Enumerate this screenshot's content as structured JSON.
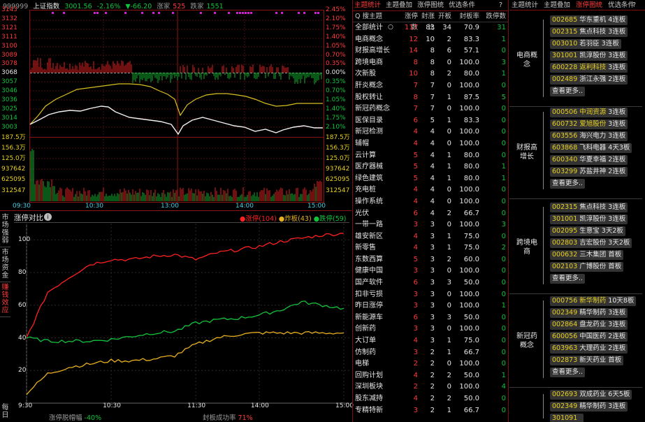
{
  "index": {
    "code": "999999",
    "name": "上证指数",
    "price": "3001.56",
    "pct": "-2.16%",
    "change": "▼-66.20",
    "up_label": "涨家",
    "up_count": "525",
    "down_label": "跌家",
    "down_count": "1551",
    "y_left": [
      "3143",
      "3132",
      "3121",
      "3111",
      "3100",
      "3089",
      "3078",
      "3068",
      "3057",
      "3046",
      "3036",
      "3025",
      "3014",
      "3003"
    ],
    "y_right": [
      "2.45%",
      "2.10%",
      "1.75%",
      "1.40%",
      "1.05%",
      "0.70%",
      "0.35%",
      "0.00%",
      "0.35%",
      "0.70%",
      "1.05%",
      "1.40%",
      "1.75%",
      "2.10%"
    ],
    "vol_left": [
      "187.5万",
      "156.3万",
      "125.0万",
      "937642",
      "625095",
      "312547"
    ],
    "vol_right": [
      "187.5万",
      "156.3万",
      "125.0万",
      "937642",
      "625095",
      "312547"
    ],
    "x_ticks": [
      "09:30",
      "10:30",
      "13:00",
      "14:00",
      "15:00"
    ]
  },
  "compare": {
    "title": "涨停对比",
    "legend": [
      {
        "label": "涨停(104)",
        "color": "#ff2020"
      },
      {
        "label": "炸板(43)",
        "color": "#e8b020"
      },
      {
        "label": "跌停(59)",
        "color": "#12c43b"
      }
    ],
    "x_ticks": [
      "9:30",
      "10:30",
      "11:30",
      "14:00",
      "15:00"
    ],
    "footer_a_label": "涨停脱帽幅",
    "footer_a_value": "-40%",
    "footer_b_label": "封板成功率",
    "footer_b_value": "71%",
    "side_tabs": [
      "市场强弱",
      "市场资金",
      "赚钱效应",
      "每日"
    ]
  },
  "chart_data": {
    "type": "line",
    "x": [
      "9:30",
      "10:30",
      "11:30",
      "14:00",
      "15:00"
    ],
    "ylim": [
      0,
      110
    ],
    "y_ticks": [
      20,
      40,
      60,
      80,
      100
    ],
    "series": [
      {
        "name": "涨停",
        "color": "#ff2020",
        "values": [
          [
            0,
            40
          ],
          [
            15,
            68
          ],
          [
            30,
            77
          ],
          [
            45,
            85
          ],
          [
            60,
            88
          ],
          [
            75,
            88
          ],
          [
            90,
            90
          ],
          [
            105,
            91
          ],
          [
            120,
            88
          ],
          [
            135,
            92
          ],
          [
            150,
            94
          ],
          [
            165,
            96
          ],
          [
            180,
            99
          ],
          [
            195,
            101
          ],
          [
            210,
            103
          ],
          [
            225,
            104
          ]
        ]
      },
      {
        "name": "炸板",
        "color": "#e8b020",
        "values": [
          [
            0,
            6
          ],
          [
            15,
            18
          ],
          [
            30,
            22
          ],
          [
            45,
            24
          ],
          [
            60,
            26
          ],
          [
            75,
            26
          ],
          [
            90,
            27
          ],
          [
            105,
            29
          ],
          [
            120,
            36
          ],
          [
            135,
            40
          ],
          [
            150,
            42
          ],
          [
            165,
            43
          ],
          [
            180,
            43
          ],
          [
            195,
            43
          ],
          [
            210,
            43
          ],
          [
            225,
            43
          ]
        ]
      },
      {
        "name": "跌停",
        "color": "#12c43b",
        "values": [
          [
            0,
            40
          ],
          [
            15,
            38
          ],
          [
            30,
            38
          ],
          [
            45,
            38
          ],
          [
            60,
            39
          ],
          [
            75,
            41
          ],
          [
            90,
            43
          ],
          [
            105,
            44
          ],
          [
            120,
            49
          ],
          [
            135,
            51
          ],
          [
            150,
            52
          ],
          [
            165,
            54
          ],
          [
            180,
            57
          ],
          [
            195,
            62
          ],
          [
            210,
            60
          ],
          [
            225,
            58
          ]
        ]
      }
    ]
  },
  "table": {
    "tabs": [
      {
        "label": "主题统计",
        "on": true
      },
      {
        "label": "主题叠加",
        "on": false
      },
      {
        "label": "涨停图统",
        "on": false
      },
      {
        "label": "优选条件",
        "on": false
      }
    ],
    "help": "?",
    "headers": [
      "Q 搜主题",
      "涨停数",
      "封涨比",
      "开板",
      "封板率",
      "跌停数"
    ],
    "rows": [
      [
        "全部统计",
        "117",
        "83",
        "34",
        "70.9",
        "31"
      ],
      [
        "电商概念",
        "12",
        "10",
        "2",
        "83.3",
        "1"
      ],
      [
        "财报高增长",
        "14",
        "8",
        "6",
        "57.1",
        "0"
      ],
      [
        "跨境电商",
        "8",
        "8",
        "0",
        "100.0",
        "3"
      ],
      [
        "次新股",
        "10",
        "8",
        "2",
        "80.0",
        "1"
      ],
      [
        "肝炎概念",
        "7",
        "7",
        "0",
        "100.0",
        "0"
      ],
      [
        "股权转让",
        "8",
        "7",
        "1",
        "87.5",
        "5"
      ],
      [
        "新冠药概念",
        "7",
        "7",
        "0",
        "100.0",
        "0"
      ],
      [
        "医保目录",
        "6",
        "5",
        "1",
        "83.3",
        "0"
      ],
      [
        "新冠检测",
        "4",
        "4",
        "0",
        "100.0",
        "0"
      ],
      [
        "辅帽",
        "4",
        "4",
        "0",
        "100.0",
        "0"
      ],
      [
        "云计算",
        "5",
        "4",
        "1",
        "80.0",
        "0"
      ],
      [
        "医疗器械",
        "5",
        "4",
        "1",
        "80.0",
        "1"
      ],
      [
        "绿色建筑",
        "5",
        "4",
        "1",
        "80.0",
        "1"
      ],
      [
        "充电桩",
        "4",
        "4",
        "0",
        "100.0",
        "0"
      ],
      [
        "操作系统",
        "4",
        "4",
        "0",
        "100.0",
        "0"
      ],
      [
        "光伏",
        "6",
        "4",
        "2",
        "66.7",
        "0"
      ],
      [
        "一带一路",
        "3",
        "3",
        "0",
        "100.0",
        "3"
      ],
      [
        "雄安新区",
        "4",
        "3",
        "1",
        "75.0",
        "0"
      ],
      [
        "新零售",
        "4",
        "3",
        "1",
        "75.0",
        "2"
      ],
      [
        "东数西算",
        "5",
        "3",
        "2",
        "60.0",
        "0"
      ],
      [
        "健康中国",
        "3",
        "3",
        "0",
        "100.0",
        "0"
      ],
      [
        "国产软件",
        "6",
        "3",
        "3",
        "50.0",
        "0"
      ],
      [
        "扣非亏损",
        "3",
        "3",
        "0",
        "100.0",
        "0"
      ],
      [
        "昨日涨停",
        "3",
        "3",
        "0",
        "100.0",
        "1"
      ],
      [
        "新能源车",
        "6",
        "3",
        "3",
        "50.0",
        "0"
      ],
      [
        "创新药",
        "3",
        "3",
        "0",
        "100.0",
        "0"
      ],
      [
        "大订单",
        "4",
        "3",
        "1",
        "75.0",
        "0"
      ],
      [
        "仿制药",
        "3",
        "2",
        "1",
        "66.7",
        "0"
      ],
      [
        "电梯",
        "2",
        "2",
        "0",
        "100.0",
        "0"
      ],
      [
        "回购计划",
        "4",
        "2",
        "2",
        "50.0",
        "1"
      ],
      [
        "深圳板块",
        "2",
        "2",
        "0",
        "100.0",
        "4"
      ],
      [
        "股东减持",
        "4",
        "2",
        "2",
        "50.0",
        "0"
      ],
      [
        "专精特新",
        "3",
        "2",
        "1",
        "66.7",
        "0"
      ]
    ]
  },
  "right": {
    "tabs": [
      {
        "label": "主题统计",
        "on": false
      },
      {
        "label": "主题叠加",
        "on": false
      },
      {
        "label": "涨停图统",
        "on": true
      },
      {
        "label": "优选条件",
        "on": false
      }
    ],
    "help": "?",
    "more_label": "查看更多..",
    "groups": [
      {
        "label": "电商概念",
        "stocks": [
          [
            "002685",
            "华东重机",
            "4连板",
            false
          ],
          [
            "002315",
            "焦点科技",
            "3连板",
            false
          ],
          [
            "003010",
            "若羽臣",
            "3连板",
            false
          ],
          [
            "301001",
            "凯淳股份",
            "3连板",
            false
          ],
          [
            "600228",
            "返利科技",
            "3连板",
            true
          ],
          [
            "002489",
            "浙江永强",
            "2连板",
            false
          ]
        ]
      },
      {
        "label": "财报高增长",
        "stocks": [
          [
            "000506",
            "中润资源",
            "3连板",
            true
          ],
          [
            "600732",
            "爱旭股份",
            "3连板",
            true
          ],
          [
            "603556",
            "海兴电力",
            "3连板",
            false
          ],
          [
            "603868",
            "飞科电器",
            "4天3板",
            false
          ],
          [
            "600340",
            "华夏幸福",
            "2连板",
            false
          ],
          [
            "603299",
            "苏盐井神",
            "2连板",
            false
          ]
        ]
      },
      {
        "label": "跨境电商",
        "stocks": [
          [
            "002315",
            "焦点科技",
            "3连板",
            false
          ],
          [
            "301001",
            "凯淳股份",
            "3连板",
            false
          ],
          [
            "002095",
            "生意宝",
            "3天2板",
            false
          ],
          [
            "002803",
            "吉宏股份",
            "3天2板",
            false
          ],
          [
            "000632",
            "三木集团",
            "首板",
            false
          ],
          [
            "002103",
            "广博股份",
            "首板",
            false
          ]
        ]
      },
      {
        "label": "新冠药概念",
        "stocks": [
          [
            "000756",
            "新华制药",
            "10天8板",
            true
          ],
          [
            "002349",
            "精华制药",
            "3连板",
            false
          ],
          [
            "002864",
            "盘龙药业",
            "3连板",
            false
          ],
          [
            "600056",
            "中国医药",
            "2连板",
            false
          ],
          [
            "603963",
            "大理药业",
            "2连板",
            false
          ],
          [
            "002873",
            "新天药业",
            "首板",
            false
          ]
        ]
      },
      {
        "label": "",
        "stocks": [
          [
            "002693",
            "双成药业",
            "6天5板",
            false
          ],
          [
            "002349",
            "精华制药",
            "3连板",
            false
          ],
          [
            "301091",
            "",
            "",
            false
          ]
        ]
      }
    ]
  }
}
